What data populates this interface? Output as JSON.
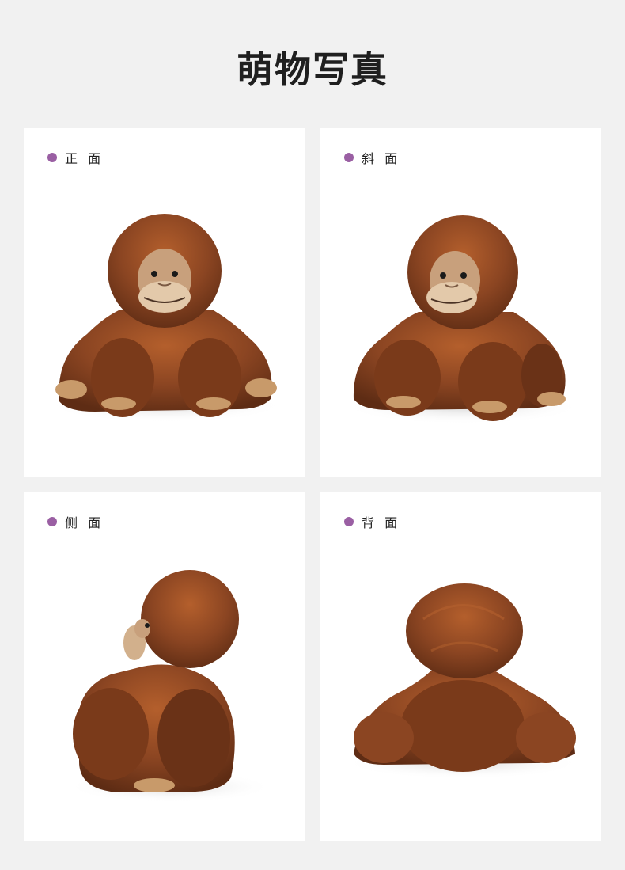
{
  "header": {
    "title": "萌物写真"
  },
  "cards": [
    {
      "label": "正 面",
      "image": "orangutan-plush-front-photo",
      "view": "front"
    },
    {
      "label": "斜 面",
      "image": "orangutan-plush-angled-photo",
      "view": "angled"
    },
    {
      "label": "侧 面",
      "image": "orangutan-plush-side-photo",
      "view": "side"
    },
    {
      "label": "背 面",
      "image": "orangutan-plush-back-photo",
      "view": "back"
    }
  ],
  "colors": {
    "background": "#f1f1f1",
    "card": "#ffffff",
    "label_dot": "#9a5fa3",
    "fur_dark": "#5e2c14",
    "fur_mid": "#8b4522",
    "fur_light": "#b45f2c",
    "face": "#c8a07c",
    "muzzle": "#e3c9aa"
  }
}
